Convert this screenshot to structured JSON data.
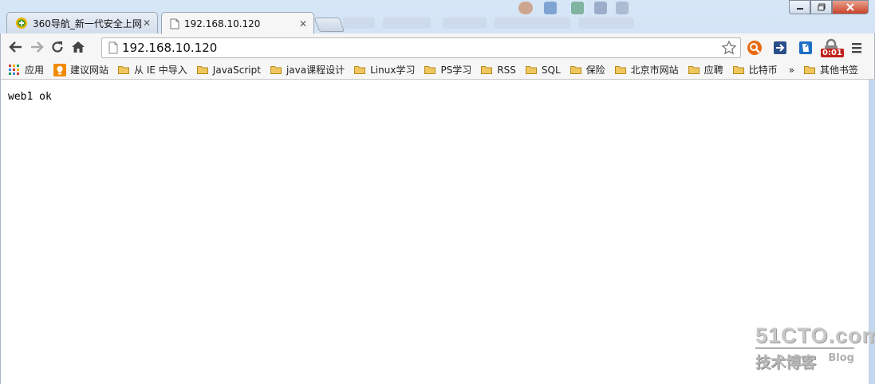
{
  "tabs": [
    {
      "title": "360导航_新一代安全上网",
      "active": false
    },
    {
      "title": "192.168.10.120",
      "active": true
    }
  ],
  "address": {
    "value": "192.168.10.120"
  },
  "extensions": {
    "timer_badge": "0:01"
  },
  "bookmarks": {
    "apps_label": "应用",
    "items": [
      "建议网站",
      "从 IE 中导入",
      "JavaScript",
      "java课程设计",
      "Linux学习",
      "PS学习",
      "RSS",
      "SQL",
      "保险",
      "北京市网站",
      "应聘",
      "比特币"
    ],
    "overflow": "»",
    "other": "其他书签"
  },
  "page": {
    "text": "web1 ok"
  },
  "watermark": {
    "logo": "51CTO.com",
    "sub": "技术博客",
    "blog": "Blog"
  },
  "colors": {
    "accent": "#1a73e8",
    "folder": "#f0c75e",
    "close": "#c9442a"
  }
}
